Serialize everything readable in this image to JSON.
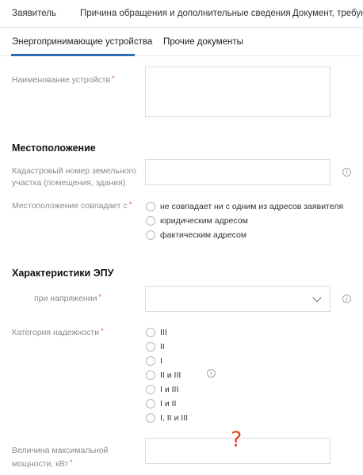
{
  "top_tabs": [
    "Заявитель",
    "Причина обращения и дополнительные сведения",
    "Документ, требующ"
  ],
  "sub_tabs": [
    "Энергопринимающие устройства",
    "Прочие документы"
  ],
  "device_name": {
    "label": "Наименование устройств",
    "value": ""
  },
  "location": {
    "title": "Местоположение",
    "cadastral_label_1": "Кадастровый номер земельного",
    "cadastral_label_2": "участка (помещения, здания)",
    "cadastral_value": "",
    "match_label": "Местоположение совпадает с",
    "match_options": [
      "не совпадает ни с одним из адресов заявителя",
      "юридическим адресом",
      "фактическим адресом"
    ]
  },
  "epu": {
    "title": "Характеристики ЭПУ",
    "voltage_label": "при напряжении",
    "voltage_value": "",
    "category_label": "Категория надежности",
    "categories": [
      "III",
      "II",
      "I",
      "II и III",
      "I и III",
      "I и II",
      "I, II и III"
    ],
    "power_label_1": "Величина максимальной",
    "power_label_2": "мощности, кВт",
    "power_value": ""
  },
  "required_mark": "*",
  "info_glyph": "i",
  "annotation": "?",
  "colors": {
    "accent": "#2f6db5",
    "required": "#d9534f",
    "annotation": "#e0462b"
  }
}
